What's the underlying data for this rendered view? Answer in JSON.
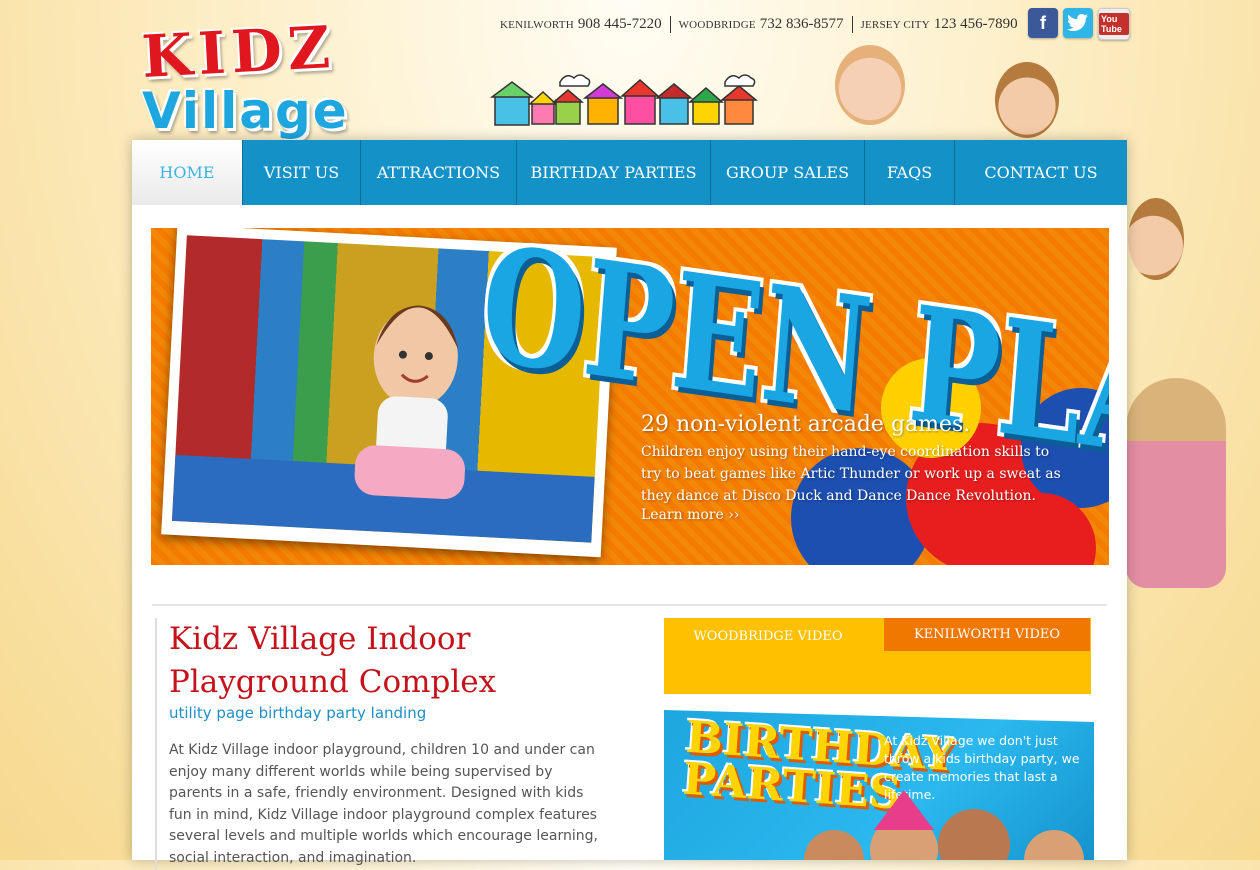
{
  "header": {
    "locations": [
      {
        "city": "KENILWORTH",
        "phone": "908 445-7220"
      },
      {
        "city": "WOODBRIDGE",
        "phone": "732 836-8577"
      },
      {
        "city": "JERSEY CITY",
        "phone": "123 456-7890"
      }
    ],
    "social": [
      {
        "name": "facebook-icon",
        "glyph": "f"
      },
      {
        "name": "twitter-icon",
        "glyph": "t"
      },
      {
        "name": "youtube-icon",
        "glyph": "You Tube"
      }
    ],
    "logo": {
      "line1": "KIDZ",
      "line2": "Village"
    }
  },
  "nav": {
    "items": [
      "HOME",
      "VISIT US",
      "ATTRACTIONS",
      "BIRTHDAY PARTIES",
      "GROUP SALES",
      "FAQS",
      "CONTACT US"
    ],
    "active": "HOME"
  },
  "hero": {
    "title": "OPEN PLAY",
    "heading": "29 non-violent arcade games.",
    "text": "Children enjoy using their hand-eye coordination skills to try to beat games like Artic Thunder or work up a sweat as they dance at Disco Duck and Dance Dance Revolution.",
    "link": "Learn more ››"
  },
  "main": {
    "title": "Kidz Village Indoor Playground Complex",
    "subtitle": "utility page birthday party landing",
    "body": "At Kidz Village indoor playground, children 10 and under can enjoy many different worlds while being supervised by parents in a safe, friendly environment. Designed with kids fun in mind, Kidz Village indoor playground complex features several levels and multiple worlds which encourage learning, social interaction, and imagination."
  },
  "video_tabs": [
    "WOODBRIDGE VIDEO",
    "KENILWORTH VIDEO"
  ],
  "promo": {
    "title_line1": "BIRTHDAY",
    "title_line2": "PARTIES",
    "text": "At Kidz Village we don't just throw a kids birthday party, we create memories that last a lifetime."
  },
  "colors": {
    "nav_blue": "#1492c8",
    "title_red": "#c4131b",
    "subtitle_blue": "#1e8fc7",
    "tab_yellow": "#ffc000",
    "tab_orange": "#f07800",
    "hero_orange": "#f57a00"
  }
}
